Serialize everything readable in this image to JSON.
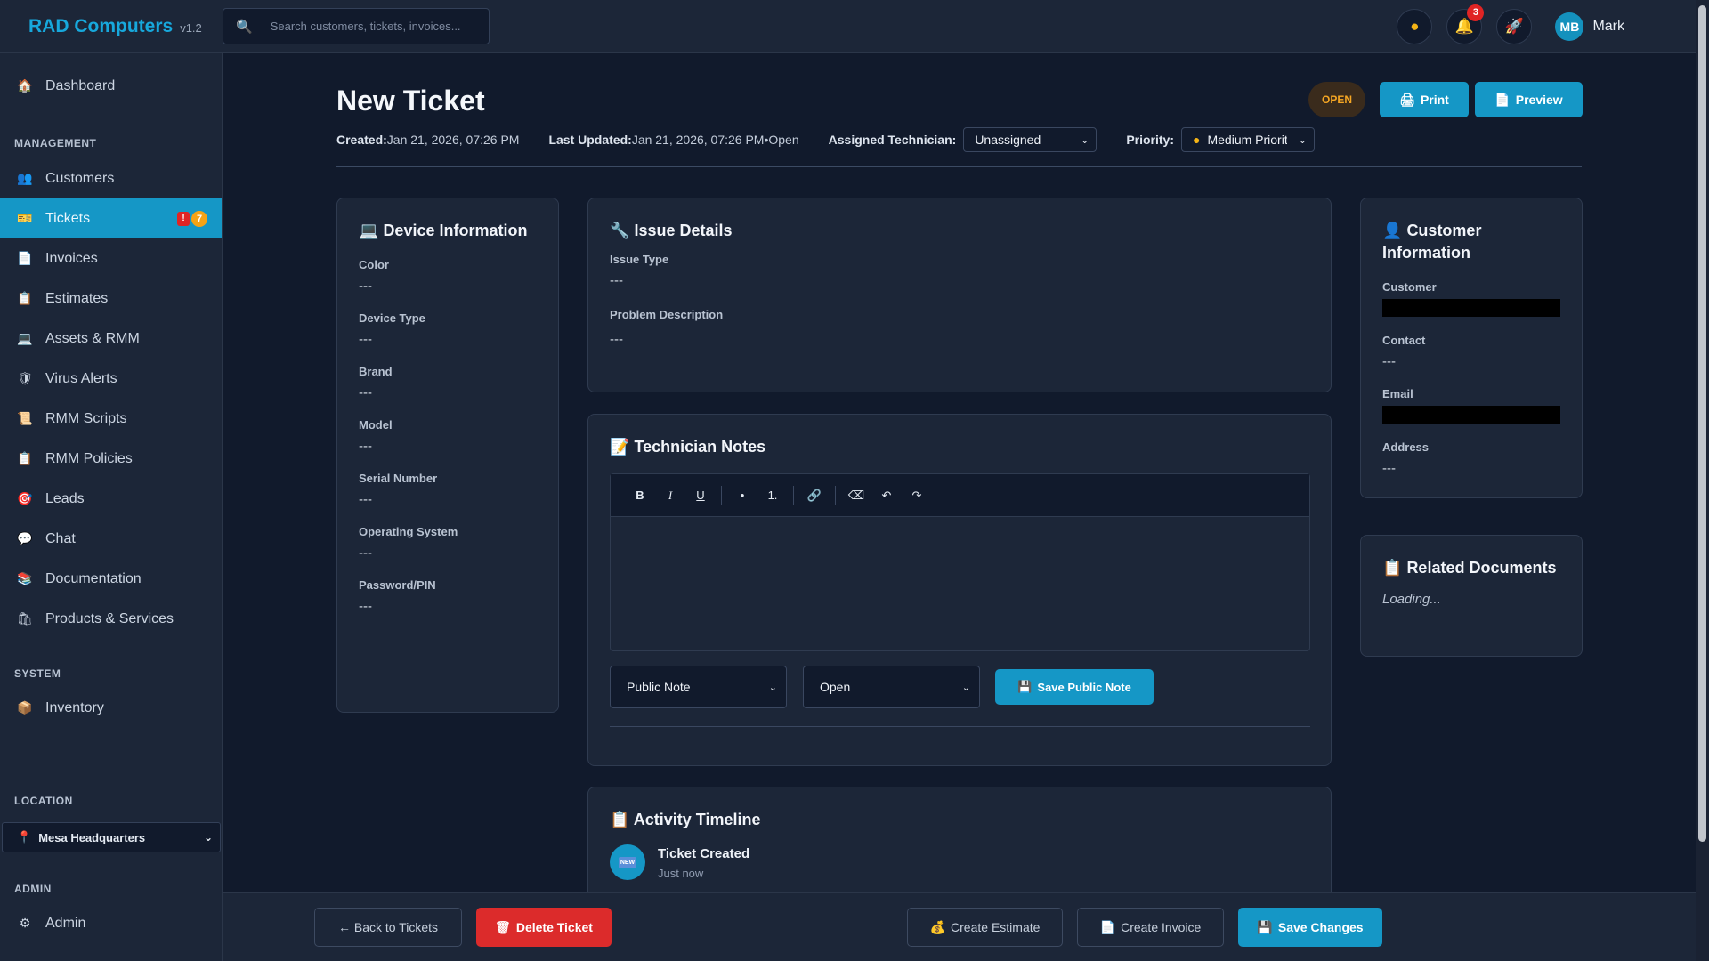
{
  "brand": {
    "name": "RAD Computers",
    "version": "v1.2"
  },
  "search": {
    "placeholder": "Search customers, tickets, invoices..."
  },
  "topbar": {
    "notification_count": "3",
    "user_initials": "MB",
    "user_name": "Mark"
  },
  "sidebar": {
    "dashboard": "Dashboard",
    "management_label": "MANAGEMENT",
    "management": [
      {
        "label": "Customers",
        "icon": "👥"
      },
      {
        "label": "Tickets",
        "icon": "🎫"
      },
      {
        "label": "Invoices",
        "icon": "📄"
      },
      {
        "label": "Estimates",
        "icon": "📋"
      },
      {
        "label": "Assets & RMM",
        "icon": "💻"
      },
      {
        "label": "Virus Alerts",
        "icon": "🛡"
      },
      {
        "label": "RMM Scripts",
        "icon": "📜"
      },
      {
        "label": "RMM Policies",
        "icon": "📋"
      },
      {
        "label": "Leads",
        "icon": "🎯"
      },
      {
        "label": "Chat",
        "icon": "💬"
      },
      {
        "label": "Documentation",
        "icon": "📚"
      },
      {
        "label": "Products & Services",
        "icon": "🛍"
      }
    ],
    "tickets_alert": "!",
    "tickets_count": "7",
    "system_label": "SYSTEM",
    "inventory": "Inventory",
    "location_label": "LOCATION",
    "location_value": "Mesa Headquarters",
    "admin_label": "ADMIN",
    "admin": "Admin"
  },
  "ticket": {
    "title": "New Ticket",
    "created_label": "Created:",
    "created_value": "Jan 21, 2026, 07:26 PM",
    "updated_label": "Last Updated:",
    "updated_value": "Jan 21, 2026, 07:26 PM",
    "status_inline": "•Open",
    "technician_label": "Assigned Technician:",
    "technician_value": "Unassigned",
    "priority_label": "Priority:",
    "priority_value": "Medium Priorit",
    "status_badge": "OPEN",
    "print": "Print",
    "preview": "Preview"
  },
  "device": {
    "title": "Device Information",
    "fields": [
      {
        "label": "Color",
        "value": "---"
      },
      {
        "label": "Device Type",
        "value": "---"
      },
      {
        "label": "Brand",
        "value": "---"
      },
      {
        "label": "Model",
        "value": "---"
      },
      {
        "label": "Serial Number",
        "value": "---"
      },
      {
        "label": "Operating System",
        "value": "---"
      },
      {
        "label": "Password/PIN",
        "value": "---"
      }
    ]
  },
  "issue": {
    "title": "Issue Details",
    "type_label": "Issue Type",
    "type_value": "---",
    "desc_label": "Problem Description",
    "desc_value": "---"
  },
  "notes": {
    "title": "Technician Notes",
    "note_type": "Public Note",
    "note_status": "Open",
    "save": "Save Public Note"
  },
  "timeline": {
    "title": "Activity Timeline",
    "item_icon": "NEW",
    "item_title": "Ticket Created",
    "item_time": "Just now"
  },
  "customer": {
    "title": "Customer Information",
    "customer_label": "Customer",
    "contact_label": "Contact",
    "contact_value": "---",
    "email_label": "Email",
    "address_label": "Address",
    "address_value": "---"
  },
  "related": {
    "title": "Related Documents",
    "status": "Loading..."
  },
  "footer": {
    "back": "← Back to Tickets",
    "delete": "Delete Ticket",
    "estimate": "Create Estimate",
    "invoice": "Create Invoice",
    "save": "Save Changes"
  }
}
